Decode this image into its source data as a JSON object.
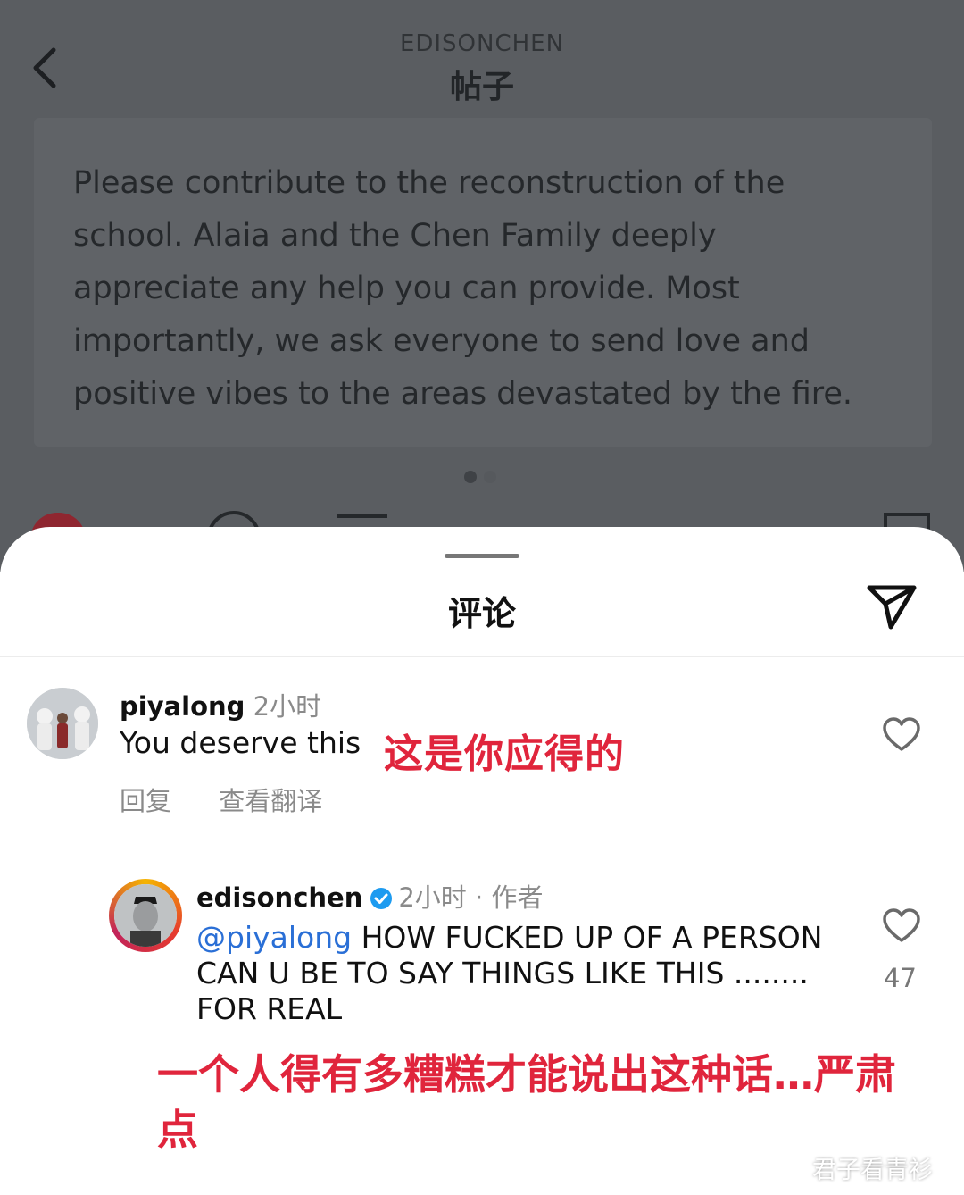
{
  "header": {
    "username": "EDISONCHEN",
    "title": "帖子"
  },
  "post": {
    "text": "Please contribute to the reconstruction of the school. Alaia and the Chen Family deeply appreciate any help you can provide. Most importantly, we ask everyone to send love and positive vibes to the areas devastated by the fire."
  },
  "sheet": {
    "title": "评论"
  },
  "comments": [
    {
      "username": "piyalong",
      "time": "2小时",
      "text": "You deserve this",
      "annotation": "这是你应得的",
      "reply_label": "回复",
      "translate_label": "查看翻译"
    },
    {
      "username": "edisonchen",
      "time": "2小时",
      "author_tag": "· 作者",
      "mention": "@piyalong",
      "text": " HOW FUCKED UP OF A PERSON CAN U BE TO SAY THINGS LIKE THIS ........ FOR REAL",
      "likes": "47",
      "annotation": "一个人得有多糟糕才能说出这种话…严肃点"
    }
  ],
  "watermark": "君子看青衫",
  "colors": {
    "annotation_red": "#e0253c",
    "mention_blue": "#2a6fd6",
    "verified_blue": "#1d9bf0"
  },
  "icons": [
    "back-icon",
    "heart-icon",
    "comment-icon",
    "send-icon",
    "bookmark-icon",
    "share-icon",
    "verified-icon"
  ]
}
